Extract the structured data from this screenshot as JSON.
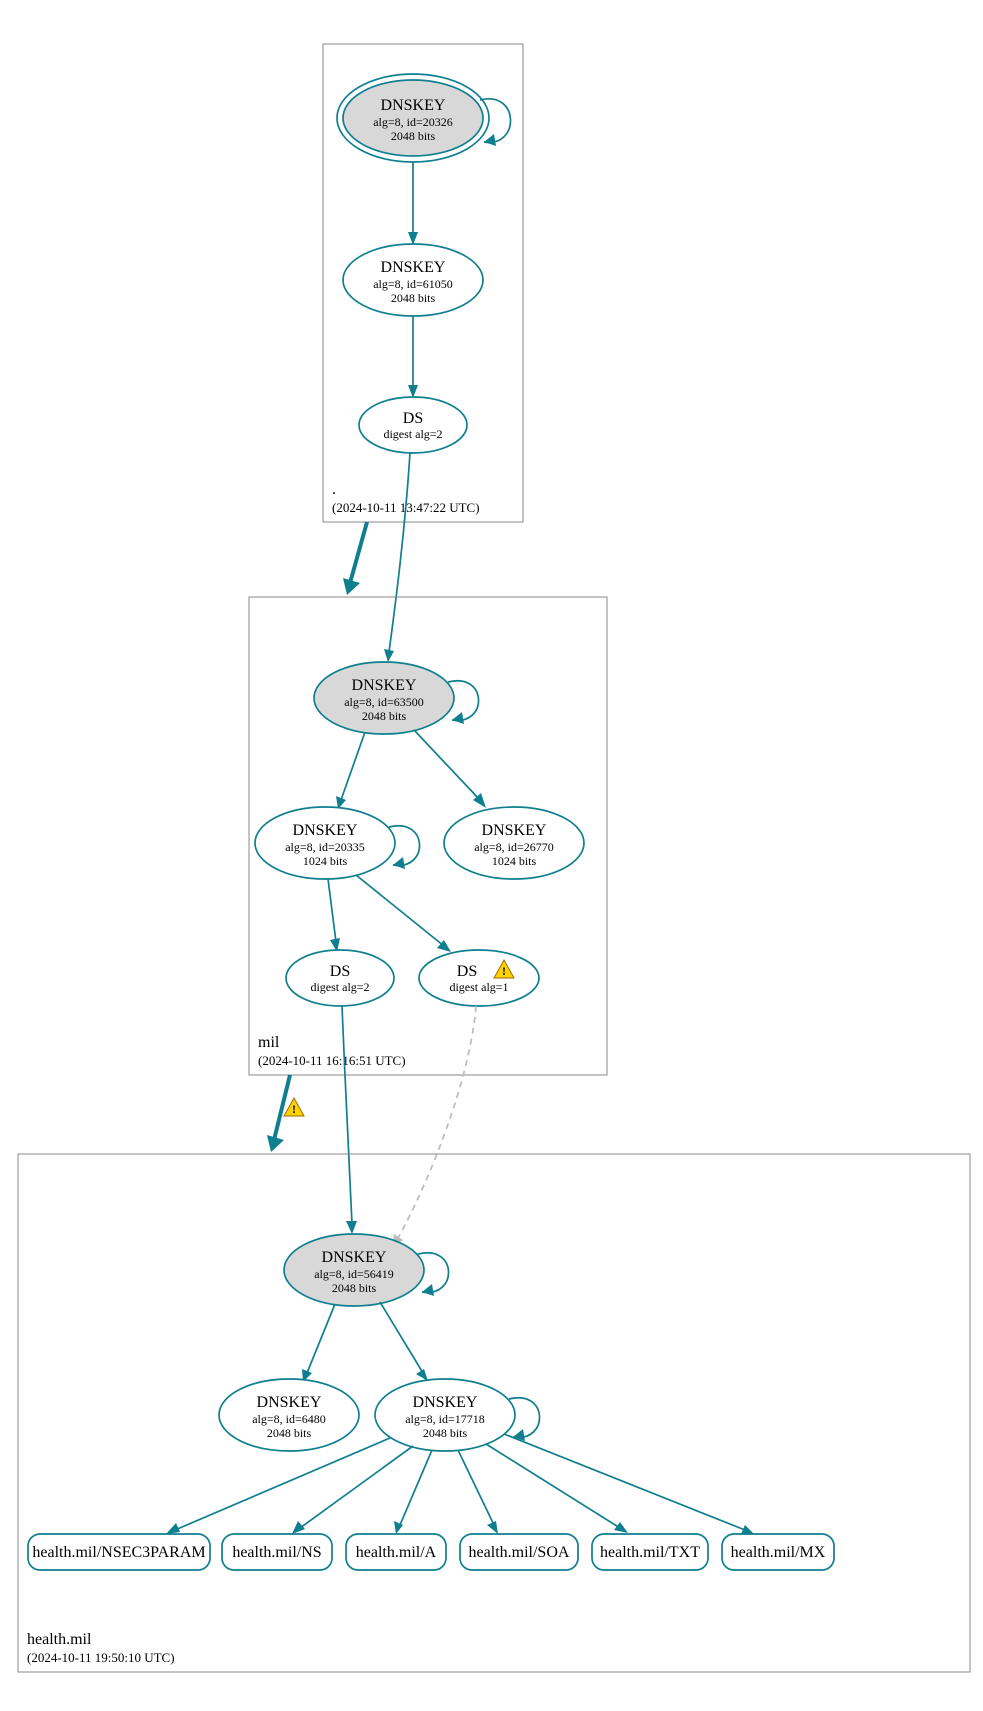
{
  "colors": {
    "stroke": "#0f7f8f",
    "node_fill": "#d8d8d8",
    "warn_fill": "#ffd300",
    "dashed": "#bbbbbb"
  },
  "zones": {
    "root": {
      "name": ".",
      "timestamp": "(2024-10-11 13:47:22 UTC)"
    },
    "mil": {
      "name": "mil",
      "timestamp": "(2024-10-11 16:16:51 UTC)"
    },
    "health": {
      "name": "health.mil",
      "timestamp": "(2024-10-11 19:50:10 UTC)"
    }
  },
  "nodes": {
    "root_ksk": {
      "title": "DNSKEY",
      "line2": "alg=8, id=20326",
      "line3": "2048 bits"
    },
    "root_zsk": {
      "title": "DNSKEY",
      "line2": "alg=8, id=61050",
      "line3": "2048 bits"
    },
    "root_ds": {
      "title": "DS",
      "line2": "digest alg=2"
    },
    "mil_ksk": {
      "title": "DNSKEY",
      "line2": "alg=8, id=63500",
      "line3": "2048 bits"
    },
    "mil_zsk1": {
      "title": "DNSKEY",
      "line2": "alg=8, id=20335",
      "line3": "1024 bits"
    },
    "mil_zsk2": {
      "title": "DNSKEY",
      "line2": "alg=8, id=26770",
      "line3": "1024 bits"
    },
    "mil_ds1": {
      "title": "DS",
      "line2": "digest alg=2"
    },
    "mil_ds2": {
      "title": "DS",
      "line2": "digest alg=1"
    },
    "health_ksk": {
      "title": "DNSKEY",
      "line2": "alg=8, id=56419",
      "line3": "2048 bits"
    },
    "health_zsk1": {
      "title": "DNSKEY",
      "line2": "alg=8, id=6480",
      "line3": "2048 bits"
    },
    "health_zsk2": {
      "title": "DNSKEY",
      "line2": "alg=8, id=17718",
      "line3": "2048 bits"
    }
  },
  "records": {
    "r1": "health.mil/NSEC3PARAM",
    "r2": "health.mil/NS",
    "r3": "health.mil/A",
    "r4": "health.mil/SOA",
    "r5": "health.mil/TXT",
    "r6": "health.mil/MX"
  }
}
